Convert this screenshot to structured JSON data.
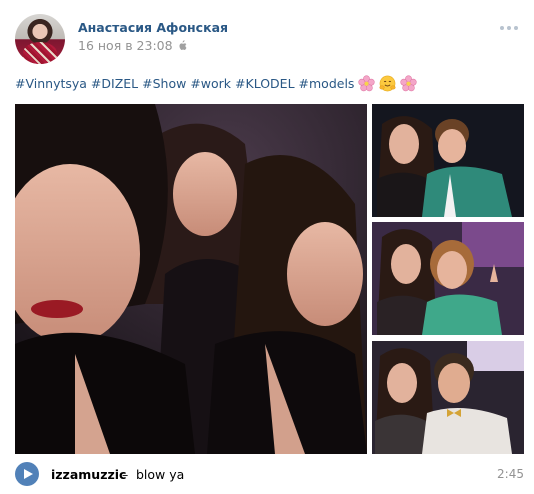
{
  "post": {
    "author": "Анастасия Афонская",
    "date": "16 ноя в 23:08",
    "platform_icon": "apple-icon",
    "menu_icon": "more-icon",
    "hashtags": [
      "#Vinnytsya",
      "#DIZEL",
      "#Show",
      "#work",
      "#KLODEL",
      "#models"
    ],
    "emojis": [
      "cherry-blossom-icon",
      "hugging-face-icon",
      "cherry-blossom-icon"
    ]
  },
  "photos": {
    "main": "selfie-three-women",
    "side": [
      "photo-woman-with-man-green-jacket",
      "photo-woman-with-woman-victory-sign",
      "photo-woman-with-man-bowtie"
    ]
  },
  "audio": {
    "artist": "izzamuzzic",
    "separator": "–",
    "title": "blow ya",
    "duration": "2:45"
  },
  "colors": {
    "link": "#2a5885",
    "meta": "#939393",
    "accent": "#5181b8"
  }
}
